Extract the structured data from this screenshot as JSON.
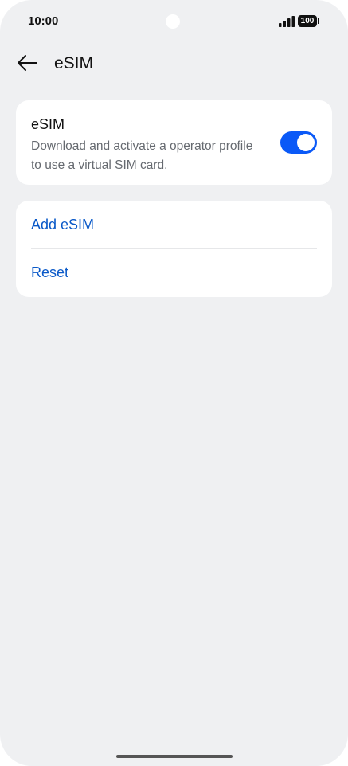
{
  "status_bar": {
    "time": "10:00",
    "battery_level": "100",
    "signal_icon": "signal-bars-icon"
  },
  "header": {
    "back_icon": "arrow-left-icon",
    "title": "eSIM"
  },
  "esim_card": {
    "title": "eSIM",
    "description": "Download and activate a operator profile to use a virtual SIM card.",
    "toggle_on": true
  },
  "actions": {
    "add_label": "Add eSIM",
    "reset_label": "Reset"
  },
  "colors": {
    "accent": "#0a59f7",
    "link": "#0a59c8",
    "background": "#eff0f2",
    "card": "#ffffff"
  }
}
